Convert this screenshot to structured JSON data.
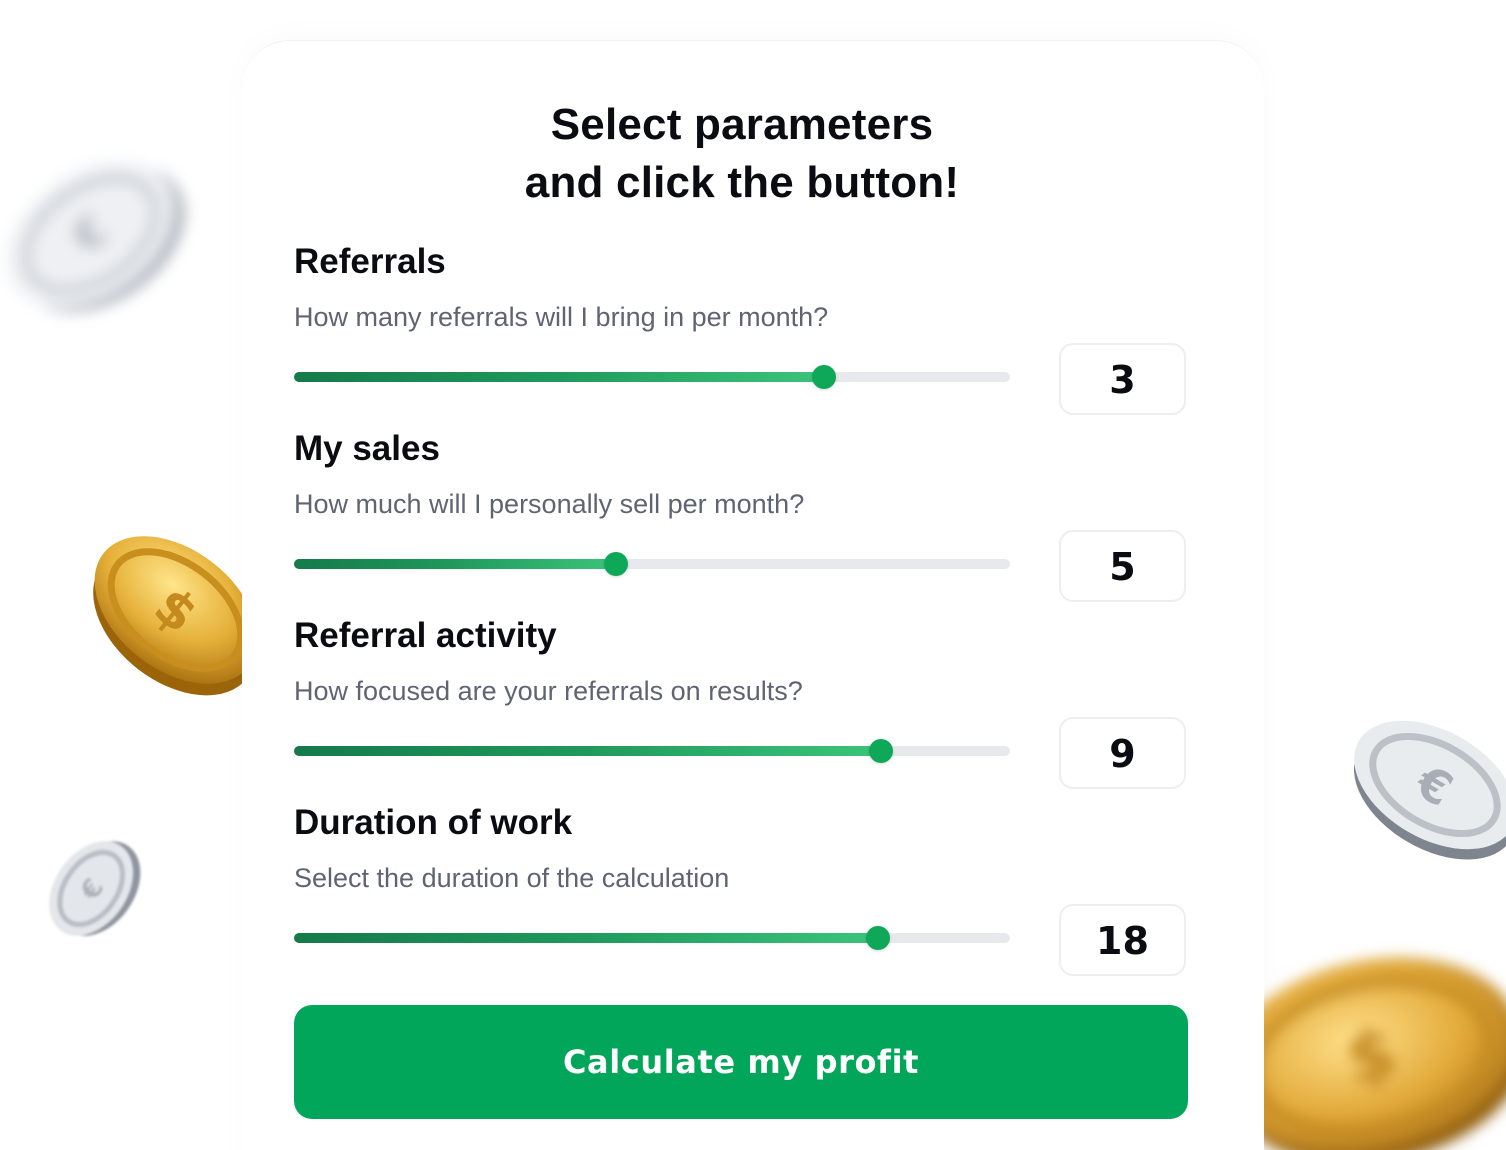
{
  "header": {
    "title_line1": "Select parameters",
    "title_line2": "and click the button!"
  },
  "params": [
    {
      "title": "Referrals",
      "subtitle": "How many referrals will I bring in per month?",
      "value": "3",
      "fill_percent": 74
    },
    {
      "title": "My sales",
      "subtitle": "How much will I personally sell per month?",
      "value": "5",
      "fill_percent": 45
    },
    {
      "title": "Referral activity",
      "subtitle": "How focused are your referrals on results?",
      "value": "9",
      "fill_percent": 82
    },
    {
      "title": "Duration of work",
      "subtitle": "Select the duration of the calculation",
      "value": "18",
      "fill_percent": 81.5
    }
  ],
  "cta": {
    "label": "Calculate my profit"
  },
  "colors": {
    "accent": "#02a65a",
    "thumb": "#0fa858",
    "track": "#e8e9ec",
    "text": "#0b0b12",
    "subtext": "#5f6473"
  },
  "decorations": {
    "coins": [
      "silver-coin-icon",
      "gold-coin-icon",
      "silver-coin-icon",
      "silver-coin-icon",
      "gold-coin-icon"
    ]
  }
}
